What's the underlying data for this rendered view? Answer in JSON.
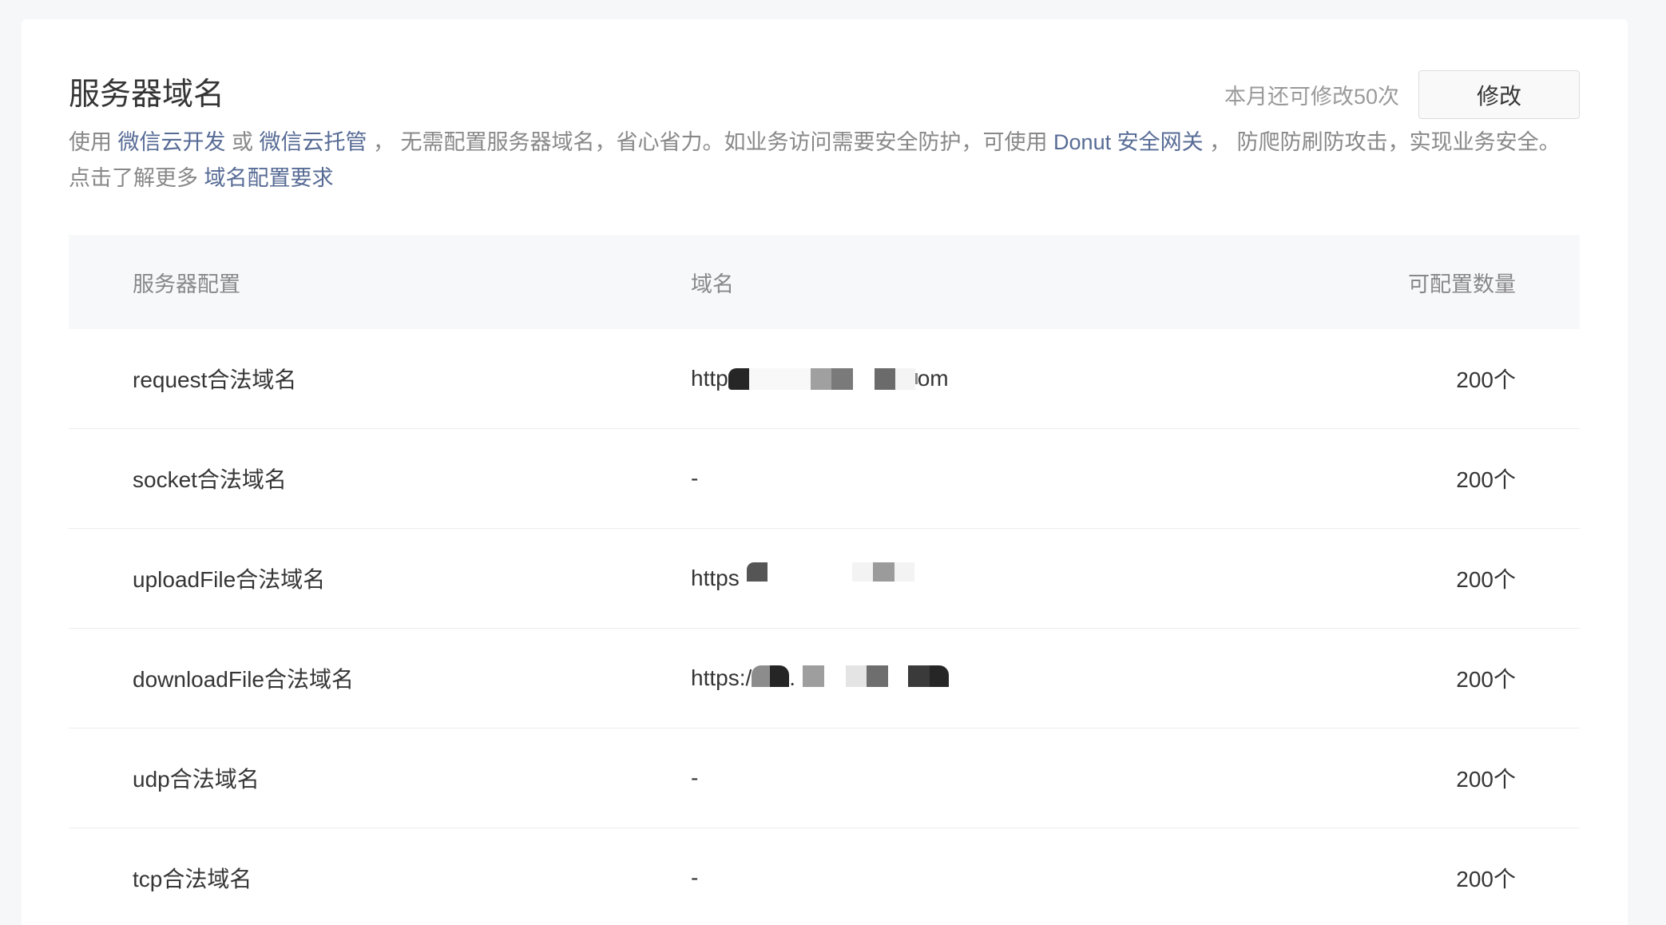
{
  "page": {
    "title": "服务器域名",
    "quota_text": "本月还可修改50次",
    "edit_button": "修改"
  },
  "description": {
    "t1": "使用 ",
    "link1": "微信云开发",
    "t2": " 或 ",
    "link2": "微信云托管",
    "t3": " ， 无需配置服务器域名，省心省力。如业务访问需要安全防护，可使用 ",
    "link3": "Donut 安全网关",
    "t4": " ， 防爬防刷防攻击，实现业务安全。点击了解更多 ",
    "link4": "域名配置要求"
  },
  "table": {
    "headers": {
      "config": "服务器配置",
      "domain": "域名",
      "count": "可配置数量"
    },
    "rows": [
      {
        "config": "request合法域名",
        "domain_prefix": "http",
        "domain_suffix": "om",
        "count": "200个"
      },
      {
        "config": "socket合法域名",
        "domain": "-",
        "count": "200个"
      },
      {
        "config": "uploadFile合法域名",
        "domain_prefix": "https",
        "count": "200个"
      },
      {
        "config": "downloadFile合法域名",
        "domain_prefix": "https:/",
        "domain_mid": ".",
        "count": "200个"
      },
      {
        "config": "udp合法域名",
        "domain": "-",
        "count": "200个"
      },
      {
        "config": "tcp合法域名",
        "domain": "-",
        "count": "200个"
      }
    ]
  },
  "colors": {
    "page_bg": "#f6f7f8",
    "link": "#576b95",
    "text_primary": "#353535",
    "text_secondary": "#888888",
    "header_bg": "#f7f8fa"
  }
}
